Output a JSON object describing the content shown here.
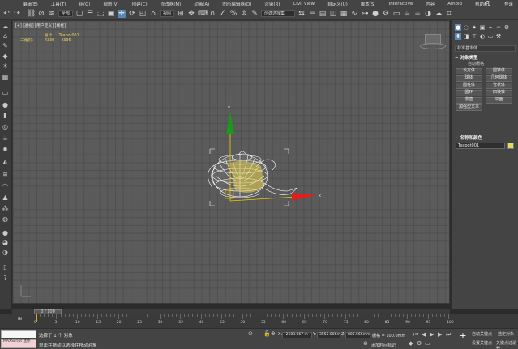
{
  "menubar": {
    "items": [
      "编辑(E)",
      "工具(T)",
      "组(G)",
      "视图(V)",
      "创建(C)",
      "修改器(M)",
      "动画(A)",
      "图形编辑器(D)",
      "渲染(R)",
      "Civil View",
      "自定义(U)",
      "脚本(S)",
      "Interactive",
      "内容",
      "Arnold",
      "帮助(H)"
    ],
    "login": "登录"
  },
  "toolbar": {
    "selection_filter": "全部",
    "reference_coord": "视图",
    "named_selection": "创建选择集"
  },
  "viewport": {
    "label": "[+] [透视] [用户定义] [线框]",
    "stats": {
      "header_col1": "总计",
      "header_col2": "Teapot001",
      "row_label": "三角形:",
      "row_total": "4336",
      "row_object": "4336"
    }
  },
  "command_panel": {
    "combo": "标准基本体",
    "section_object_type": "对象类型",
    "autogrid": "自动栅格",
    "buttons": [
      "长方体",
      "圆锥体",
      "球体",
      "几何球体",
      "圆柱体",
      "管状体",
      "圆环",
      "四棱锥",
      "茶壶",
      "平面",
      "加强型文本"
    ],
    "section_name_color": "名称和颜色",
    "object_name": "Teapot001",
    "object_color": "#e8d85c"
  },
  "timeslider": {
    "frame_display": "0 / 100"
  },
  "trackbar": {
    "ticks": [
      "0",
      "5",
      "10",
      "15",
      "20",
      "25",
      "30",
      "35",
      "40",
      "45",
      "50",
      "55",
      "60",
      "65",
      "70",
      "75",
      "80",
      "85",
      "90",
      "95",
      "100"
    ]
  },
  "statusbar": {
    "maxscript_label": "MAXScript 迷你",
    "selected_text": "选择了 1 个 对象",
    "prompt_text": "单击并拖动以选择并移动对象",
    "x_label": "X:",
    "x_value": "-2603.067 m",
    "y_label": "Y:",
    "y_value": "3555.006m",
    "z_label": "Z:",
    "z_value": "805.566mm",
    "grid_label": "栅格 = 100.0mm",
    "add_time_tag": "添加时间标记",
    "auto_key": "自动关键点",
    "selected_object": "选定对象",
    "set_key": "设置关键点",
    "key_filter": "关键点过滤器..."
  }
}
